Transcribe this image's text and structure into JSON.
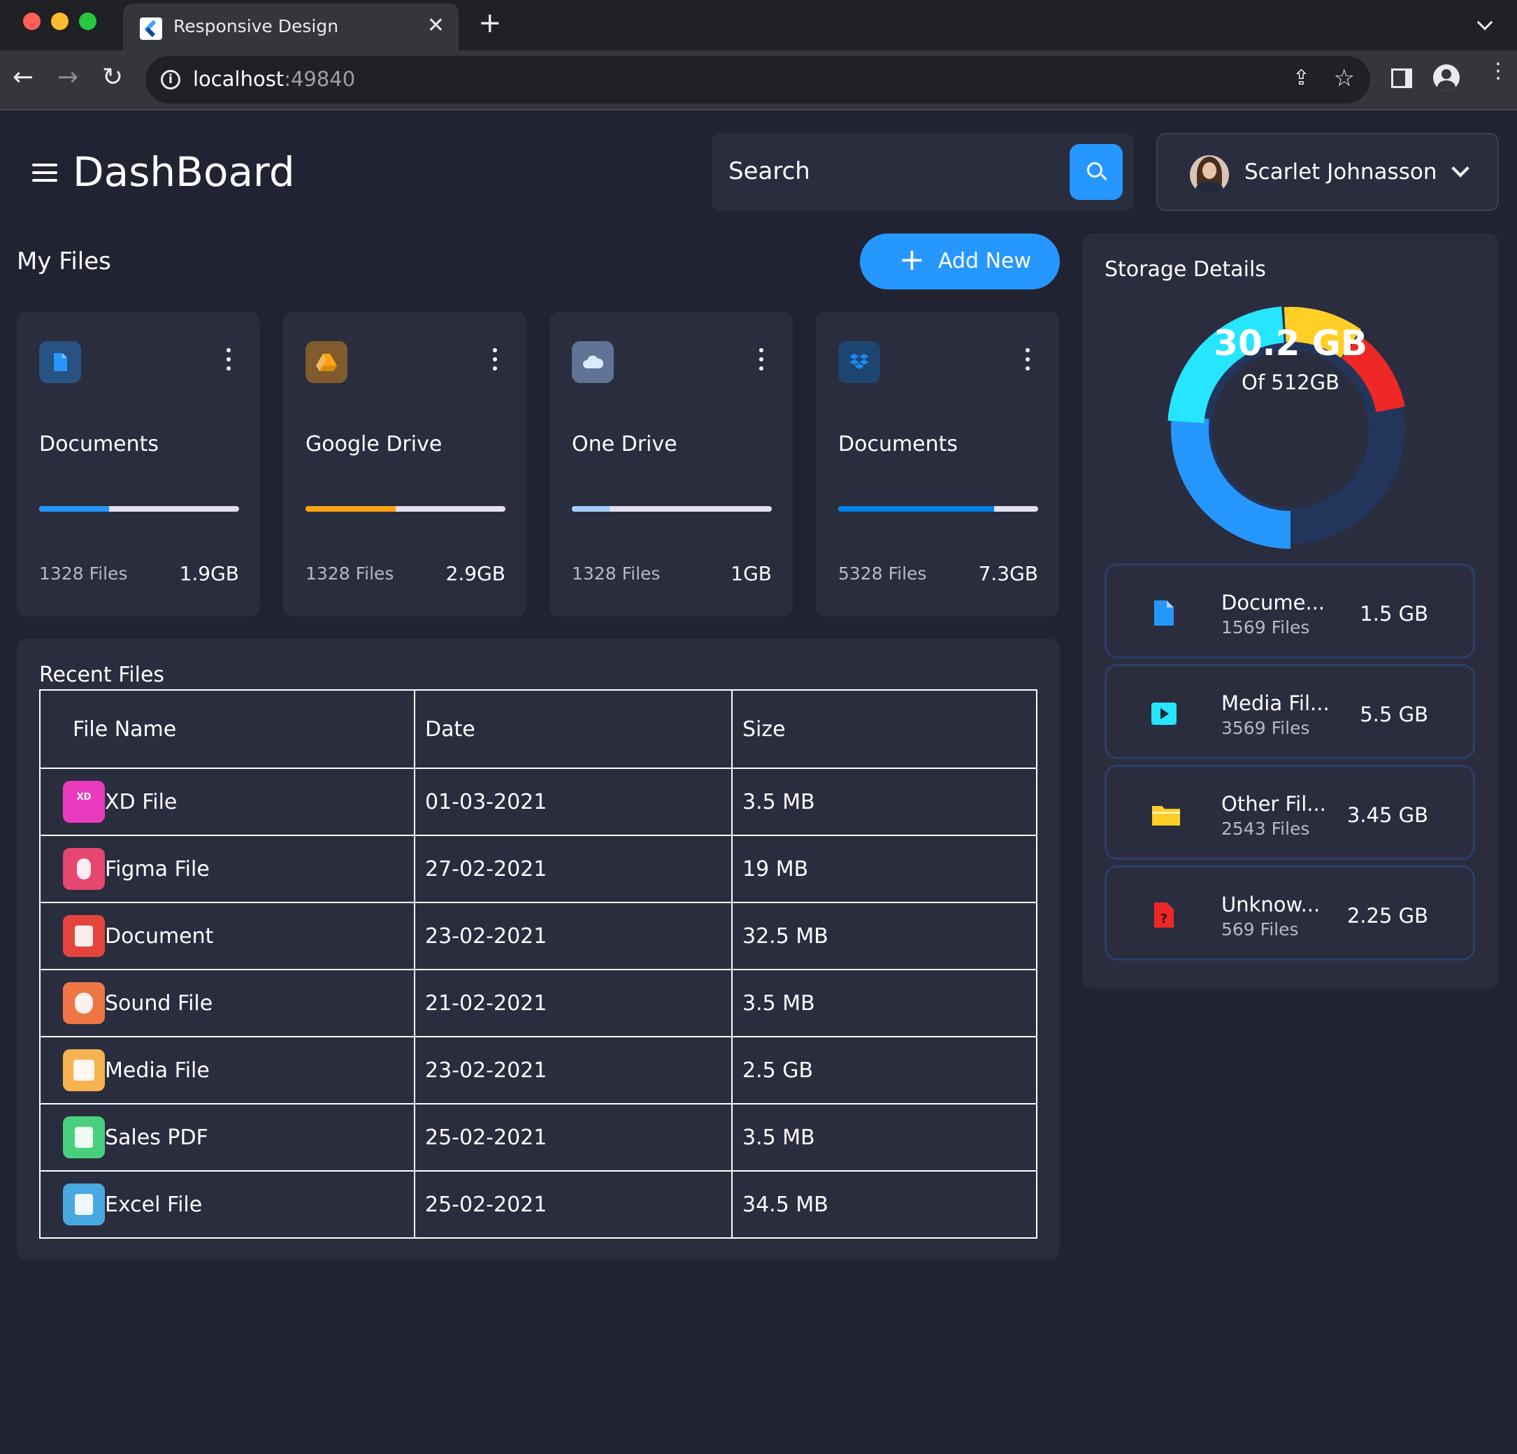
{
  "browser": {
    "tab_title": "Responsive Design",
    "url_host": "localhost",
    "url_port": ":49840"
  },
  "header": {
    "title": "DashBoard",
    "search_placeholder": "Search",
    "profile_name": "Scarlet Johnasson"
  },
  "my_files": {
    "title": "My Files",
    "add_button": "Add New",
    "cards": [
      {
        "name": "Documents",
        "files": "1328 Files",
        "size": "1.9GB",
        "color": "#2697FF",
        "progress": 0.35,
        "icon": "document-icon"
      },
      {
        "name": "Google Drive",
        "files": "1328 Files",
        "size": "2.9GB",
        "color": "#FFA113",
        "progress": 0.45,
        "icon": "google-drive-icon"
      },
      {
        "name": "One Drive",
        "files": "1328 Files",
        "size": "1GB",
        "color": "#A4CDFF",
        "progress": 0.19,
        "icon": "cloud-icon"
      },
      {
        "name": "Documents",
        "files": "5328 Files",
        "size": "7.3GB",
        "color": "#007EE5",
        "progress": 0.78,
        "icon": "dropbox-icon"
      }
    ]
  },
  "recent_files": {
    "title": "Recent Files",
    "columns": [
      "File Name",
      "Date",
      "Size"
    ],
    "rows": [
      {
        "name": "XD File",
        "date": "01-03-2021",
        "size": "3.5 MB",
        "color": "#E93BBE",
        "icon": "xd-file-icon"
      },
      {
        "name": "Figma File",
        "date": "27-02-2021",
        "size": "19 MB",
        "color": "#E5476E",
        "icon": "figma-icon"
      },
      {
        "name": "Document",
        "date": "23-02-2021",
        "size": "32.5 MB",
        "color": "#E4443C",
        "icon": "document-icon"
      },
      {
        "name": "Sound File",
        "date": "21-02-2021",
        "size": "3.5 MB",
        "color": "#EE7646",
        "icon": "sound-icon"
      },
      {
        "name": "Media File",
        "date": "23-02-2021",
        "size": "2.5 GB",
        "color": "#F7B250",
        "icon": "media-icon"
      },
      {
        "name": "Sales PDF",
        "date": "25-02-2021",
        "size": "3.5 MB",
        "color": "#49D07F",
        "icon": "pdf-icon"
      },
      {
        "name": "Excel File",
        "date": "25-02-2021",
        "size": "34.5 MB",
        "color": "#4AA8E0",
        "icon": "excel-icon"
      }
    ]
  },
  "storage": {
    "title": "Storage Details",
    "used": "30.2 GB",
    "total": "Of 512GB",
    "items": [
      {
        "title": "Docume...",
        "files": "1569 Files",
        "size": "1.5 GB",
        "color": "#2697FF",
        "icon": "document-icon"
      },
      {
        "title": "Media Fil...",
        "files": "3569 Files",
        "size": "5.5 GB",
        "color": "#26E5FF",
        "icon": "media-icon"
      },
      {
        "title": "Other Fil...",
        "files": "2543 Files",
        "size": "3.45 GB",
        "color": "#FFCF26",
        "icon": "folder-icon"
      },
      {
        "title": "Unknow...",
        "files": "569 Files",
        "size": "2.25 GB",
        "color": "#EE2727",
        "icon": "unknown-file-icon"
      }
    ]
  }
}
